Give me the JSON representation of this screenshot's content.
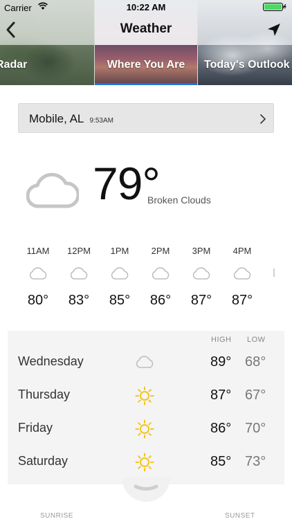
{
  "status_bar": {
    "carrier": "Carrier",
    "time": "10:22 AM"
  },
  "nav": {
    "title": "Weather",
    "back_icon": "chevron-left-icon",
    "location_icon": "location-arrow-icon"
  },
  "tabs": [
    {
      "label": "Radar",
      "active": false
    },
    {
      "label": "Where You Are",
      "active": true
    },
    {
      "label": "Today's Outlook",
      "active": false
    }
  ],
  "location": {
    "city": "Mobile, AL",
    "time": "9:53AM"
  },
  "current": {
    "temp": "79°",
    "condition": "Broken Clouds",
    "icon": "cloud-icon"
  },
  "hourly": [
    {
      "time": "11AM",
      "temp": "80°",
      "icon": "cloud-icon"
    },
    {
      "time": "12PM",
      "temp": "83°",
      "icon": "cloud-icon"
    },
    {
      "time": "1PM",
      "temp": "85°",
      "icon": "cloud-icon"
    },
    {
      "time": "2PM",
      "temp": "86°",
      "icon": "cloud-icon"
    },
    {
      "time": "3PM",
      "temp": "87°",
      "icon": "cloud-icon"
    },
    {
      "time": "4PM",
      "temp": "87°",
      "icon": "cloud-icon"
    }
  ],
  "daily": {
    "high_header": "HIGH",
    "low_header": "LOW",
    "days": [
      {
        "day": "Wednesday",
        "icon": "cloud-icon",
        "high": "89°",
        "low": "68°"
      },
      {
        "day": "Thursday",
        "icon": "sun-icon",
        "high": "87°",
        "low": "67°"
      },
      {
        "day": "Friday",
        "icon": "sun-icon",
        "high": "86°",
        "low": "70°"
      },
      {
        "day": "Saturday",
        "icon": "sun-icon",
        "high": "85°",
        "low": "73°"
      }
    ]
  },
  "bottom": {
    "sunrise_label": "SUNRISE",
    "sunset_label": "SUNSET"
  },
  "colors": {
    "accent": "#1f74d6",
    "sun": "#f2c51d",
    "cloud_stroke": "#c6c6c6",
    "battery": "#4cd964"
  }
}
